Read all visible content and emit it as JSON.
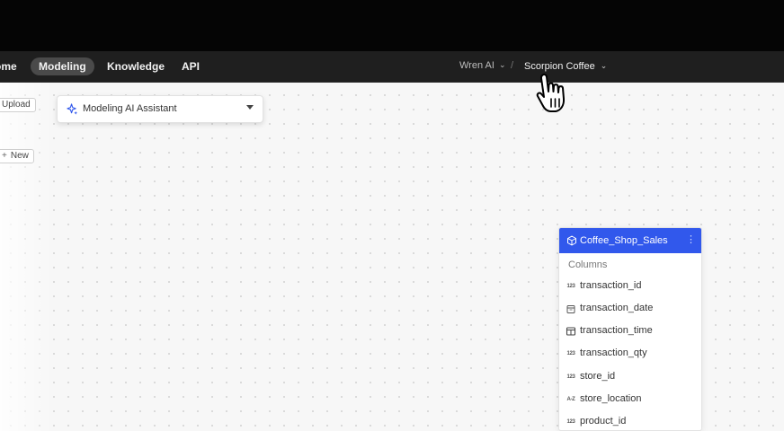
{
  "nav": {
    "items": [
      {
        "label": "ome",
        "active": false
      },
      {
        "label": "Modeling",
        "active": true
      },
      {
        "label": "Knowledge",
        "active": false
      },
      {
        "label": "API",
        "active": false
      }
    ],
    "product": "Wren AI",
    "separator": "/",
    "project": "Scorpion Coffee"
  },
  "sidebar": {
    "upload_label": "Upload",
    "new_label": "New"
  },
  "assistant": {
    "label": "Modeling AI Assistant"
  },
  "model": {
    "name": "Coffee_Shop_Sales",
    "section_label": "Columns",
    "columns": [
      {
        "type_icon": "123",
        "name": "transaction_id"
      },
      {
        "type_icon": "calendar-icon",
        "name": "transaction_date"
      },
      {
        "type_icon": "time-icon",
        "name": "transaction_time"
      },
      {
        "type_icon": "123",
        "name": "transaction_qty"
      },
      {
        "type_icon": "123",
        "name": "store_id"
      },
      {
        "type_icon": "A-Z",
        "name": "store_location"
      },
      {
        "type_icon": "123",
        "name": "product_id"
      }
    ]
  },
  "colors": {
    "accent": "#3158ec",
    "navbar": "#1f1f1f",
    "canvas": "#f7f7f7"
  }
}
